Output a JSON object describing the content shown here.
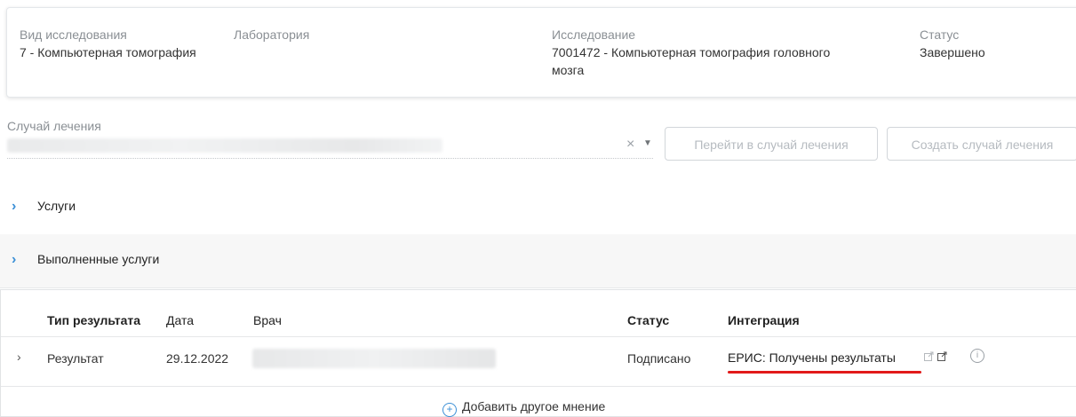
{
  "info_card": {
    "study_type_label": "Вид исследования",
    "study_type_value": "7 - Компьютерная томография",
    "lab_label": "Лаборатория",
    "study_label": "Исследование",
    "study_value_line1": "7001472 - Компьютерная томография головного",
    "study_value_line2": "мозга",
    "status_label": "Статус",
    "status_value": "Завершено"
  },
  "treatment_case": {
    "label": "Случай лечения",
    "clear_icon": "×",
    "dropdown_icon": "▼",
    "goto_button": "Перейти в случай лечения",
    "create_button": "Создать случай лечения"
  },
  "sections": {
    "services": "Услуги",
    "completed_services": "Выполненные услуги",
    "arrow_icon": "›"
  },
  "results_table": {
    "headers": [
      "Тип результата",
      "Дата",
      "Врач",
      "Статус",
      "Интеграция"
    ],
    "rows": [
      {
        "expand_icon": "›",
        "type": "Результат",
        "date": "29.12.2022",
        "status": "Подписано",
        "integration": "ЕРИС: Получены результаты"
      }
    ],
    "add_opinion_icon": "+",
    "add_opinion": "Добавить другое мнение",
    "info_icon": "i"
  },
  "colors": {
    "accent": "#3b8fd6",
    "highlight_underline": "#e21a1a",
    "muted_text": "#8a8f94"
  }
}
